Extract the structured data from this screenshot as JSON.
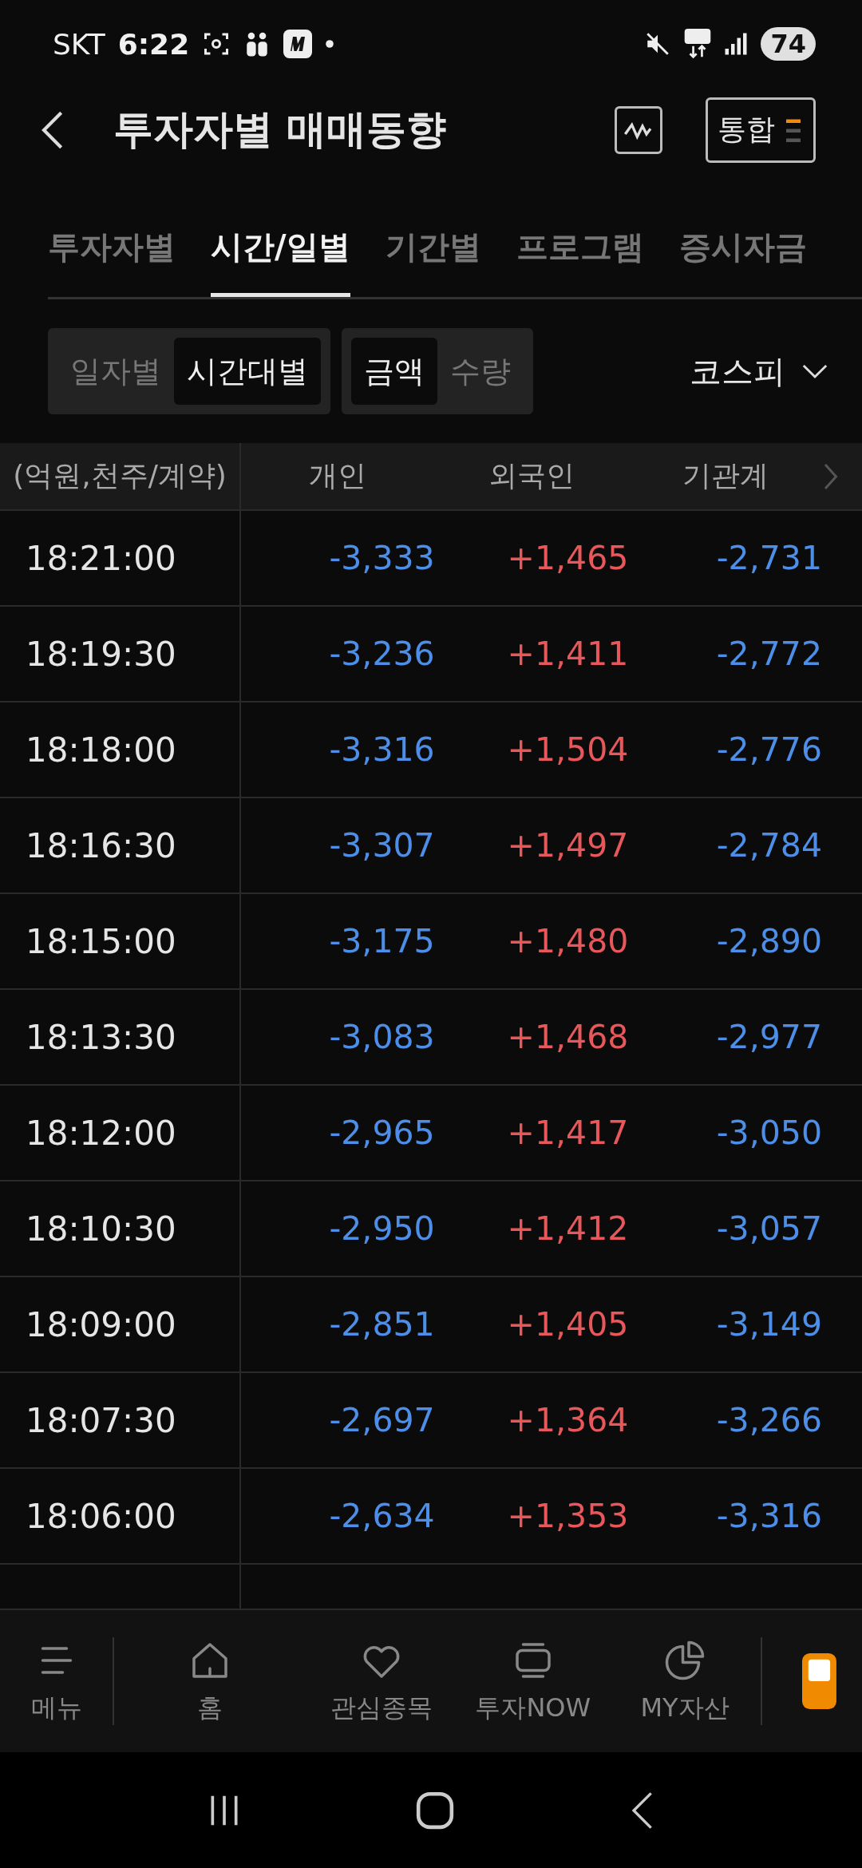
{
  "status_bar": {
    "carrier": "SKT",
    "time": "6:22",
    "battery": "74"
  },
  "header": {
    "title": "투자자별 매매동향",
    "menu_button": "통합"
  },
  "tabs": [
    {
      "label": "투자자별",
      "selected": false
    },
    {
      "label": "시간/일별",
      "selected": true
    },
    {
      "label": "기간별",
      "selected": false
    },
    {
      "label": "프로그램",
      "selected": false
    },
    {
      "label": "증시자금",
      "selected": false
    }
  ],
  "period_toggle": [
    {
      "label": "일자별",
      "selected": false
    },
    {
      "label": "시간대별",
      "selected": true
    }
  ],
  "unit_toggle": [
    {
      "label": "금액",
      "selected": true
    },
    {
      "label": "수량",
      "selected": false
    }
  ],
  "market_dropdown": {
    "label": "코스피"
  },
  "table": {
    "columns": [
      "(억원,천주/계약)",
      "개인",
      "외국인",
      "기관계"
    ],
    "rows": [
      {
        "time": "18:21:00",
        "values": [
          {
            "text": "-3,333",
            "color": "#4d8fe8"
          },
          {
            "text": "+1,465",
            "color": "#e8585a"
          },
          {
            "text": "-2,731",
            "color": "#4d8fe8"
          }
        ]
      },
      {
        "time": "18:19:30",
        "values": [
          {
            "text": "-3,236",
            "color": "#4d8fe8"
          },
          {
            "text": "+1,411",
            "color": "#e8585a"
          },
          {
            "text": "-2,772",
            "color": "#4d8fe8"
          }
        ]
      },
      {
        "time": "18:18:00",
        "values": [
          {
            "text": "-3,316",
            "color": "#4d8fe8"
          },
          {
            "text": "+1,504",
            "color": "#e8585a"
          },
          {
            "text": "-2,776",
            "color": "#4d8fe8"
          }
        ]
      },
      {
        "time": "18:16:30",
        "values": [
          {
            "text": "-3,307",
            "color": "#4d8fe8"
          },
          {
            "text": "+1,497",
            "color": "#e8585a"
          },
          {
            "text": "-2,784",
            "color": "#4d8fe8"
          }
        ]
      },
      {
        "time": "18:15:00",
        "values": [
          {
            "text": "-3,175",
            "color": "#4d8fe8"
          },
          {
            "text": "+1,480",
            "color": "#e8585a"
          },
          {
            "text": "-2,890",
            "color": "#4d8fe8"
          }
        ]
      },
      {
        "time": "18:13:30",
        "values": [
          {
            "text": "-3,083",
            "color": "#4d8fe8"
          },
          {
            "text": "+1,468",
            "color": "#e8585a"
          },
          {
            "text": "-2,977",
            "color": "#4d8fe8"
          }
        ]
      },
      {
        "time": "18:12:00",
        "values": [
          {
            "text": "-2,965",
            "color": "#4d8fe8"
          },
          {
            "text": "+1,417",
            "color": "#e8585a"
          },
          {
            "text": "-3,050",
            "color": "#4d8fe8"
          }
        ]
      },
      {
        "time": "18:10:30",
        "values": [
          {
            "text": "-2,950",
            "color": "#4d8fe8"
          },
          {
            "text": "+1,412",
            "color": "#e8585a"
          },
          {
            "text": "-3,057",
            "color": "#4d8fe8"
          }
        ]
      },
      {
        "time": "18:09:00",
        "values": [
          {
            "text": "-2,851",
            "color": "#4d8fe8"
          },
          {
            "text": "+1,405",
            "color": "#e8585a"
          },
          {
            "text": "-3,149",
            "color": "#4d8fe8"
          }
        ]
      },
      {
        "time": "18:07:30",
        "values": [
          {
            "text": "-2,697",
            "color": "#4d8fe8"
          },
          {
            "text": "+1,364",
            "color": "#e8585a"
          },
          {
            "text": "-3,266",
            "color": "#4d8fe8"
          }
        ]
      },
      {
        "time": "18:06:00",
        "values": [
          {
            "text": "-2,634",
            "color": "#4d8fe8"
          },
          {
            "text": "+1,353",
            "color": "#e8585a"
          },
          {
            "text": "-3,316",
            "color": "#4d8fe8"
          }
        ]
      }
    ]
  },
  "bottom_nav": [
    {
      "label": "메뉴"
    },
    {
      "label": "홈"
    },
    {
      "label": "관심종목"
    },
    {
      "label": "투자NOW"
    },
    {
      "label": "MY자산"
    }
  ]
}
